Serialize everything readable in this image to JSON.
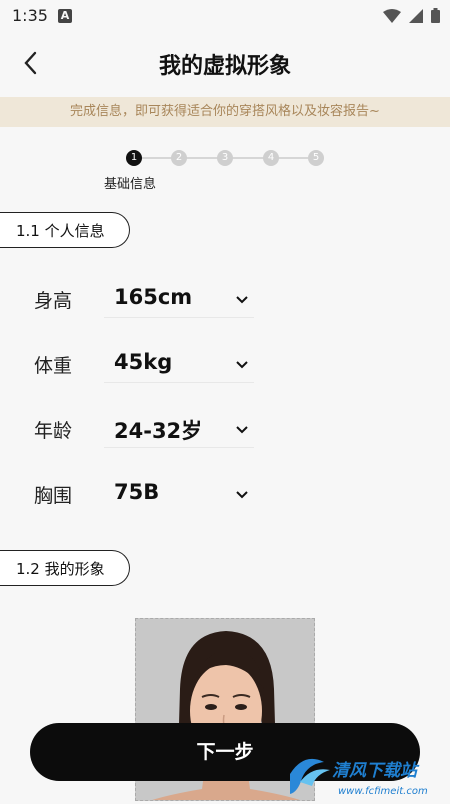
{
  "status": {
    "time": "1:35",
    "a_icon": "A"
  },
  "header": {
    "title": "我的虚拟形象",
    "back_icon": "chevron-left-icon"
  },
  "banner": {
    "text": "完成信息，即可获得适合你的穿搭风格以及妆容报告~"
  },
  "stepper": {
    "steps": [
      "1",
      "2",
      "3",
      "4",
      "5"
    ],
    "active_index": 0,
    "active_label": "基础信息"
  },
  "section1": {
    "title": "1.1 个人信息"
  },
  "form": {
    "rows": [
      {
        "label": "身高",
        "value": "165cm"
      },
      {
        "label": "体重",
        "value": "45kg"
      },
      {
        "label": "年龄",
        "value": "24-32岁"
      },
      {
        "label": "胸围",
        "value": "75B"
      }
    ]
  },
  "section2": {
    "title": "1.2 我的形象"
  },
  "footer": {
    "next_label": "下一步"
  },
  "watermark": {
    "text": "清风下载站",
    "url": "www.fcfimeit.com"
  },
  "colors": {
    "banner_bg": "#efe7d8",
    "banner_text": "#a8865a",
    "button_bg": "#0c0c0c"
  }
}
